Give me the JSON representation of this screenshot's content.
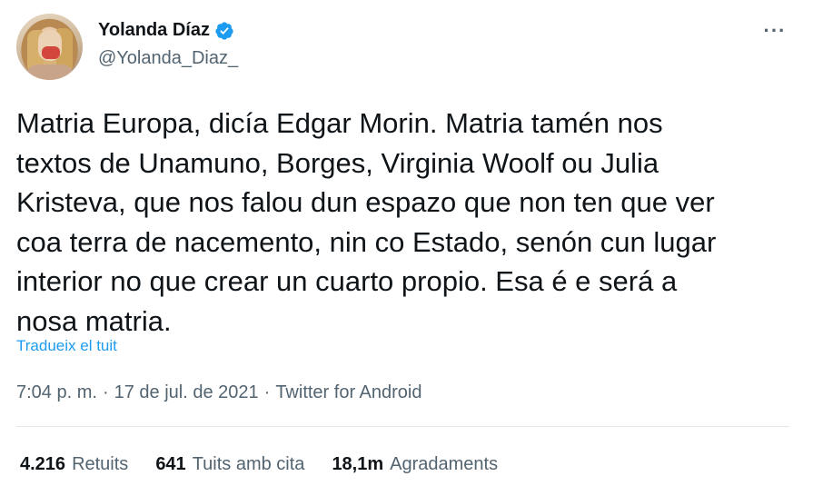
{
  "author": {
    "display_name": "Yolanda Díaz",
    "handle": "@Yolanda_Diaz_",
    "verified": true
  },
  "more_button_label": "···",
  "tweet": {
    "text_lines": [
      "Matria Europa, dicía Edgar Morin. Matria tamén nos",
      "textos de Unamuno, Borges, Virginia Woolf ou Julia",
      "Kristeva, que nos falou dun espazo que non ten que ver",
      "coa terra de nacemento, nin co Estado, senón cun lugar",
      "interior no que crear un cuarto propio. Esa é e será a",
      "nosa matria."
    ],
    "translate_label": "Tradueix el tuit"
  },
  "meta": {
    "time": "7:04 p. m.",
    "separator": "·",
    "date": "17 de jul. de 2021",
    "source": "Twitter for Android"
  },
  "stats": {
    "retweets_count": "4.216",
    "retweets_label": "Retuits",
    "quotes_count": "641",
    "quotes_label": "Tuits amb cita",
    "likes_count": "18,1m",
    "likes_label": "Agradaments"
  },
  "colors": {
    "accent": "#1d9bf0",
    "text": "#0f1419",
    "secondary": "#536471"
  }
}
